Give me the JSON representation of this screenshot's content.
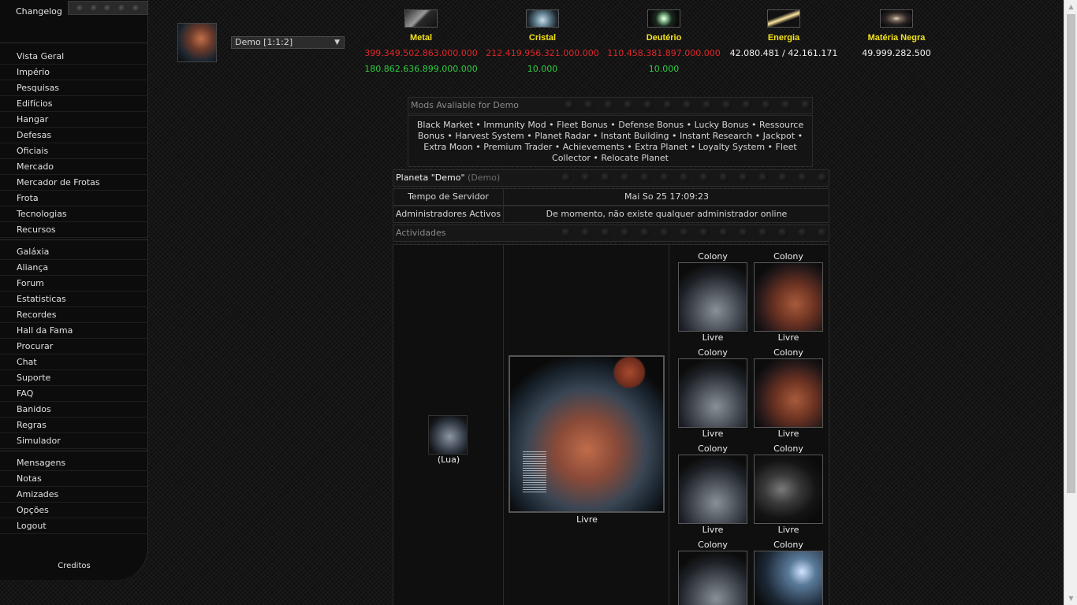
{
  "menu": {
    "changelog": "Changelog",
    "group1": [
      "Vista Geral",
      "Império",
      "Pesquisas",
      "Edifícios",
      "Hangar",
      "Defesas",
      "Oficiais",
      "Mercado",
      "Mercador de Frotas",
      "Frota",
      "Tecnologias",
      "Recursos"
    ],
    "group2": [
      "Galáxia",
      "Aliança",
      "Forum",
      "Estatisticas",
      "Recordes",
      "Hall da Fama",
      "Procurar",
      "Chat",
      "Suporte",
      "FAQ",
      "Banidos",
      "Regras",
      "Simulador"
    ],
    "group3": [
      "Mensagens",
      "Notas",
      "Amizades",
      "Opções",
      "Logout"
    ],
    "credits": "Creditos"
  },
  "planet_select": {
    "value": "Demo [1:1:2]"
  },
  "resources": {
    "metal": {
      "name": "Metal",
      "amount": "399.349.502.863.000.000",
      "production": "180.862.636.899.000.000"
    },
    "crystal": {
      "name": "Cristal",
      "amount": "212.419.956.321.000.000",
      "production": "10.000"
    },
    "deuterium": {
      "name": "Deutério",
      "amount": "110.458.381.897.000.000",
      "production": "10.000"
    },
    "energy": {
      "name": "Energia",
      "amount": "42.080.481 / 42.161.171"
    },
    "dark_matter": {
      "name": "Matéria Negra",
      "amount": "49.999.282.500"
    }
  },
  "mods": {
    "title": "Mods Avaliable for Demo",
    "items": [
      "Black Market",
      "Immunity Mod",
      "Fleet Bonus",
      "Defense Bonus",
      "Lucky Bonus",
      "Ressource Bonus",
      "Harvest System",
      "Planet Radar",
      "Instant Building",
      "Instant Research",
      "Jackpot",
      "Extra Moon",
      "Premium Trader",
      "Achievements",
      "Extra Planet",
      "Loyalty System",
      "Fleet Collector",
      "Relocate Planet"
    ]
  },
  "overview": {
    "planet_title": "Planeta \"Demo\"",
    "planet_sub": "(Demo)",
    "server_time_label": "Tempo de Servidor",
    "server_time_value": "Mai So 25 17:09:23",
    "admins_label": "Administradores Activos",
    "admins_value": "De momento, não existe qualquer administrador online",
    "activities_title": "Actividades"
  },
  "moon": {
    "label": "(Lua)"
  },
  "main_planet": {
    "label": "Livre"
  },
  "colonies": [
    {
      "title": "Colony",
      "status": "Livre"
    },
    {
      "title": "Colony",
      "status": "Livre"
    },
    {
      "title": "Colony",
      "status": "Livre"
    },
    {
      "title": "Colony",
      "status": "Livre"
    },
    {
      "title": "Colony",
      "status": "Livre"
    },
    {
      "title": "Colony",
      "status": "Livre"
    },
    {
      "title": "Colony",
      "status": ""
    },
    {
      "title": "Colony",
      "status": ""
    }
  ],
  "colors": {
    "resource_name": "#f4e31a",
    "negative": "#e0262a",
    "production": "#2ecc40"
  }
}
